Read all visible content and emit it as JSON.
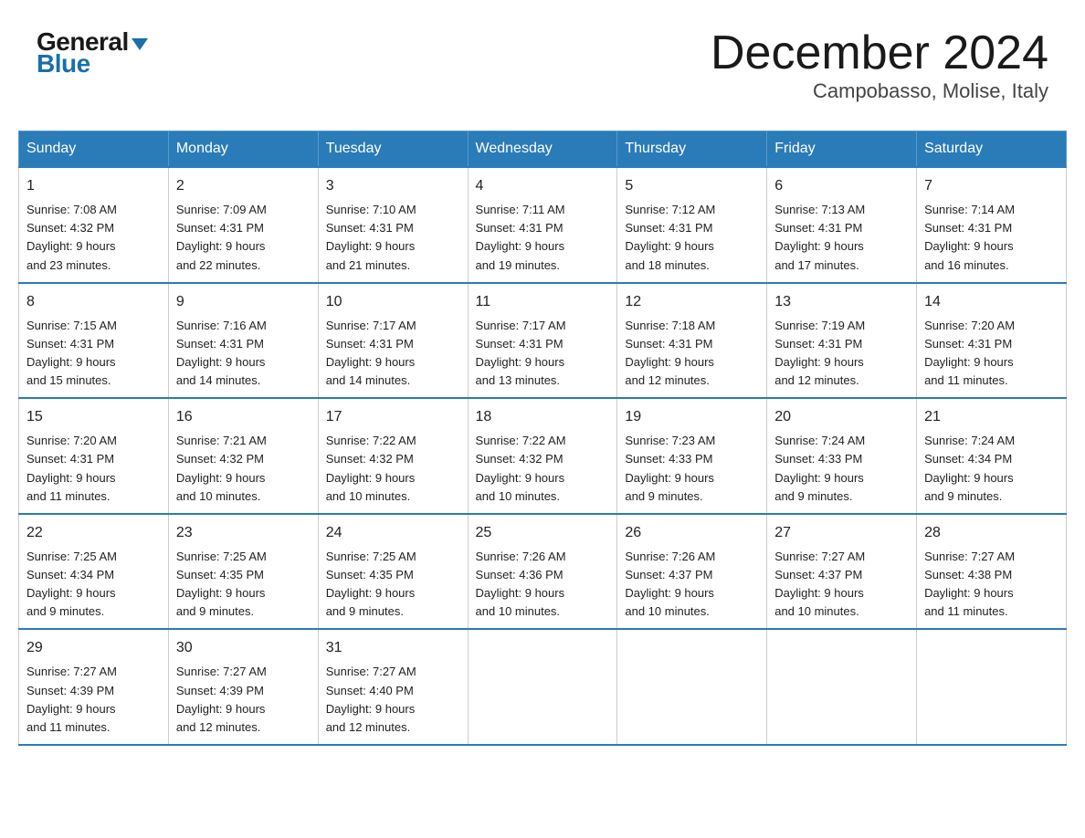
{
  "logo": {
    "general": "General",
    "blue": "Blue"
  },
  "title": "December 2024",
  "location": "Campobasso, Molise, Italy",
  "days_of_week": [
    "Sunday",
    "Monday",
    "Tuesday",
    "Wednesday",
    "Thursday",
    "Friday",
    "Saturday"
  ],
  "weeks": [
    [
      {
        "day": "1",
        "sunrise": "7:08 AM",
        "sunset": "4:32 PM",
        "daylight": "9 hours and 23 minutes."
      },
      {
        "day": "2",
        "sunrise": "7:09 AM",
        "sunset": "4:31 PM",
        "daylight": "9 hours and 22 minutes."
      },
      {
        "day": "3",
        "sunrise": "7:10 AM",
        "sunset": "4:31 PM",
        "daylight": "9 hours and 21 minutes."
      },
      {
        "day": "4",
        "sunrise": "7:11 AM",
        "sunset": "4:31 PM",
        "daylight": "9 hours and 19 minutes."
      },
      {
        "day": "5",
        "sunrise": "7:12 AM",
        "sunset": "4:31 PM",
        "daylight": "9 hours and 18 minutes."
      },
      {
        "day": "6",
        "sunrise": "7:13 AM",
        "sunset": "4:31 PM",
        "daylight": "9 hours and 17 minutes."
      },
      {
        "day": "7",
        "sunrise": "7:14 AM",
        "sunset": "4:31 PM",
        "daylight": "9 hours and 16 minutes."
      }
    ],
    [
      {
        "day": "8",
        "sunrise": "7:15 AM",
        "sunset": "4:31 PM",
        "daylight": "9 hours and 15 minutes."
      },
      {
        "day": "9",
        "sunrise": "7:16 AM",
        "sunset": "4:31 PM",
        "daylight": "9 hours and 14 minutes."
      },
      {
        "day": "10",
        "sunrise": "7:17 AM",
        "sunset": "4:31 PM",
        "daylight": "9 hours and 14 minutes."
      },
      {
        "day": "11",
        "sunrise": "7:17 AM",
        "sunset": "4:31 PM",
        "daylight": "9 hours and 13 minutes."
      },
      {
        "day": "12",
        "sunrise": "7:18 AM",
        "sunset": "4:31 PM",
        "daylight": "9 hours and 12 minutes."
      },
      {
        "day": "13",
        "sunrise": "7:19 AM",
        "sunset": "4:31 PM",
        "daylight": "9 hours and 12 minutes."
      },
      {
        "day": "14",
        "sunrise": "7:20 AM",
        "sunset": "4:31 PM",
        "daylight": "9 hours and 11 minutes."
      }
    ],
    [
      {
        "day": "15",
        "sunrise": "7:20 AM",
        "sunset": "4:31 PM",
        "daylight": "9 hours and 11 minutes."
      },
      {
        "day": "16",
        "sunrise": "7:21 AM",
        "sunset": "4:32 PM",
        "daylight": "9 hours and 10 minutes."
      },
      {
        "day": "17",
        "sunrise": "7:22 AM",
        "sunset": "4:32 PM",
        "daylight": "9 hours and 10 minutes."
      },
      {
        "day": "18",
        "sunrise": "7:22 AM",
        "sunset": "4:32 PM",
        "daylight": "9 hours and 10 minutes."
      },
      {
        "day": "19",
        "sunrise": "7:23 AM",
        "sunset": "4:33 PM",
        "daylight": "9 hours and 9 minutes."
      },
      {
        "day": "20",
        "sunrise": "7:24 AM",
        "sunset": "4:33 PM",
        "daylight": "9 hours and 9 minutes."
      },
      {
        "day": "21",
        "sunrise": "7:24 AM",
        "sunset": "4:34 PM",
        "daylight": "9 hours and 9 minutes."
      }
    ],
    [
      {
        "day": "22",
        "sunrise": "7:25 AM",
        "sunset": "4:34 PM",
        "daylight": "9 hours and 9 minutes."
      },
      {
        "day": "23",
        "sunrise": "7:25 AM",
        "sunset": "4:35 PM",
        "daylight": "9 hours and 9 minutes."
      },
      {
        "day": "24",
        "sunrise": "7:25 AM",
        "sunset": "4:35 PM",
        "daylight": "9 hours and 9 minutes."
      },
      {
        "day": "25",
        "sunrise": "7:26 AM",
        "sunset": "4:36 PM",
        "daylight": "9 hours and 10 minutes."
      },
      {
        "day": "26",
        "sunrise": "7:26 AM",
        "sunset": "4:37 PM",
        "daylight": "9 hours and 10 minutes."
      },
      {
        "day": "27",
        "sunrise": "7:27 AM",
        "sunset": "4:37 PM",
        "daylight": "9 hours and 10 minutes."
      },
      {
        "day": "28",
        "sunrise": "7:27 AM",
        "sunset": "4:38 PM",
        "daylight": "9 hours and 11 minutes."
      }
    ],
    [
      {
        "day": "29",
        "sunrise": "7:27 AM",
        "sunset": "4:39 PM",
        "daylight": "9 hours and 11 minutes."
      },
      {
        "day": "30",
        "sunrise": "7:27 AM",
        "sunset": "4:39 PM",
        "daylight": "9 hours and 12 minutes."
      },
      {
        "day": "31",
        "sunrise": "7:27 AM",
        "sunset": "4:40 PM",
        "daylight": "9 hours and 12 minutes."
      },
      null,
      null,
      null,
      null
    ]
  ],
  "labels": {
    "sunrise": "Sunrise:",
    "sunset": "Sunset:",
    "daylight": "Daylight:"
  }
}
